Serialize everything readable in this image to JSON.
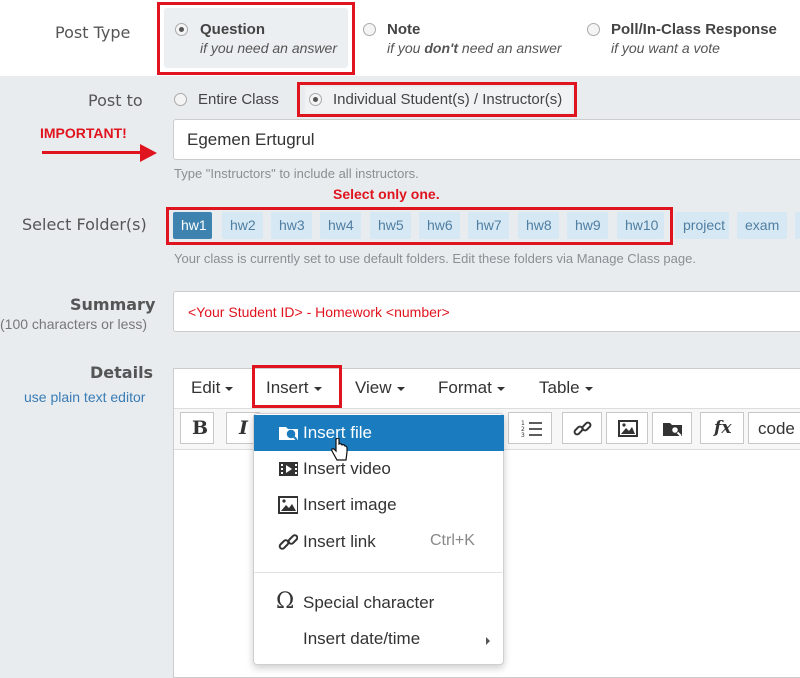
{
  "post_type": {
    "label": "Post Type",
    "options": [
      {
        "title": "Question",
        "sub": "if you need an answer"
      },
      {
        "title": "Note",
        "sub_pre": "if you ",
        "sub_em": "don't",
        "sub_post": " need an answer"
      },
      {
        "title": "Poll/In-Class Response",
        "sub": "if you want a vote"
      }
    ]
  },
  "post_to": {
    "label": "Post to",
    "options": [
      "Entire Class",
      "Individual Student(s) / Instructor(s)"
    ],
    "important": "IMPORTANT!",
    "recipient_value": "Egemen Ertugrul",
    "help": "Type \"Instructors\" to include all instructors."
  },
  "folders": {
    "label": "Select Folder(s)",
    "note": "Select only one.",
    "items": [
      "hw1",
      "hw2",
      "hw3",
      "hw4",
      "hw5",
      "hw6",
      "hw7",
      "hw8",
      "hw9",
      "hw10",
      "project",
      "exam"
    ],
    "help": "Your class is currently set to use default folders. Edit these folders via Manage Class page."
  },
  "summary": {
    "label": "Summary",
    "sublabel": "(100 characters or less)",
    "value": "<Your Student ID> - Homework <number>"
  },
  "details": {
    "label": "Details",
    "plain_link": "use plain text editor"
  },
  "editor": {
    "menus": [
      "Edit",
      "Insert",
      "View",
      "Format",
      "Table"
    ],
    "toolbar_code": "code",
    "dropdown": [
      {
        "label": "Insert file",
        "icon": "insert-file-icon"
      },
      {
        "label": "Insert video",
        "icon": "video-icon"
      },
      {
        "label": "Insert image",
        "icon": "image-icon"
      },
      {
        "label": "Insert link",
        "icon": "link-icon",
        "shortcut": "Ctrl+K"
      },
      {
        "label": "Special character",
        "icon": "omega-icon"
      },
      {
        "label": "Insert date/time",
        "icon": "submenu-arrow-icon"
      }
    ]
  },
  "colors": {
    "accent_red": "#e0141e",
    "selected_blue": "#1a7bbf",
    "folder_active": "#3e82b0"
  }
}
